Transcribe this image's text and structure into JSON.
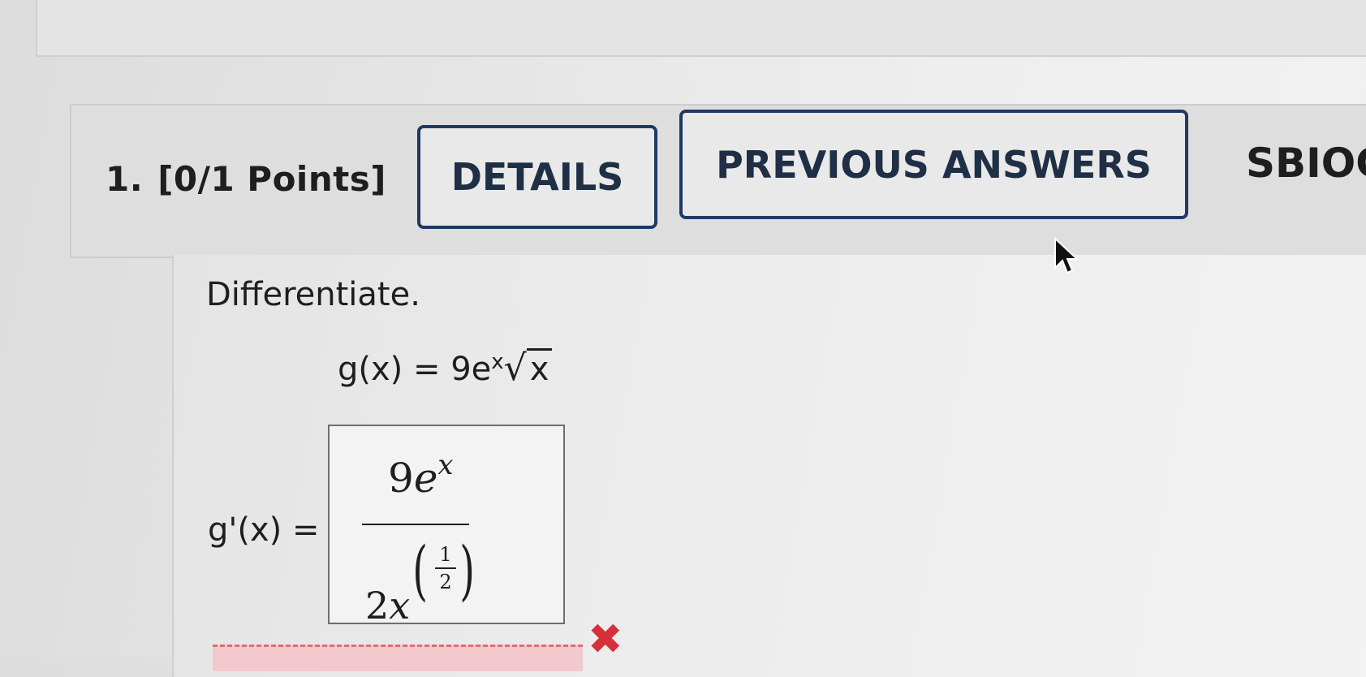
{
  "question": {
    "number": "1.",
    "points": "[0/1 Points]",
    "buttons": {
      "details": "DETAILS",
      "previous_answers": "PREVIOUS ANSWERS"
    },
    "source_label": "SBIOC",
    "prompt": "Differentiate.",
    "function": {
      "lhs": "g(x) = 9e",
      "exp": "x",
      "radicand": "x"
    },
    "derivative_label": "g'(x) =",
    "answer": {
      "numerator_coeff": "9",
      "numerator_base": "e",
      "numerator_exp": "x",
      "denominator_coeff": "2",
      "denominator_var": "x",
      "exponent_numerator": "1",
      "exponent_denominator": "2"
    },
    "status": "incorrect"
  },
  "colors": {
    "button_border": "#1f3a63",
    "wrong_mark": "#d6303b",
    "feedback_strip": "#f1c9cd"
  },
  "icons": [
    "close-icon",
    "mouse-pointer-icon"
  ]
}
